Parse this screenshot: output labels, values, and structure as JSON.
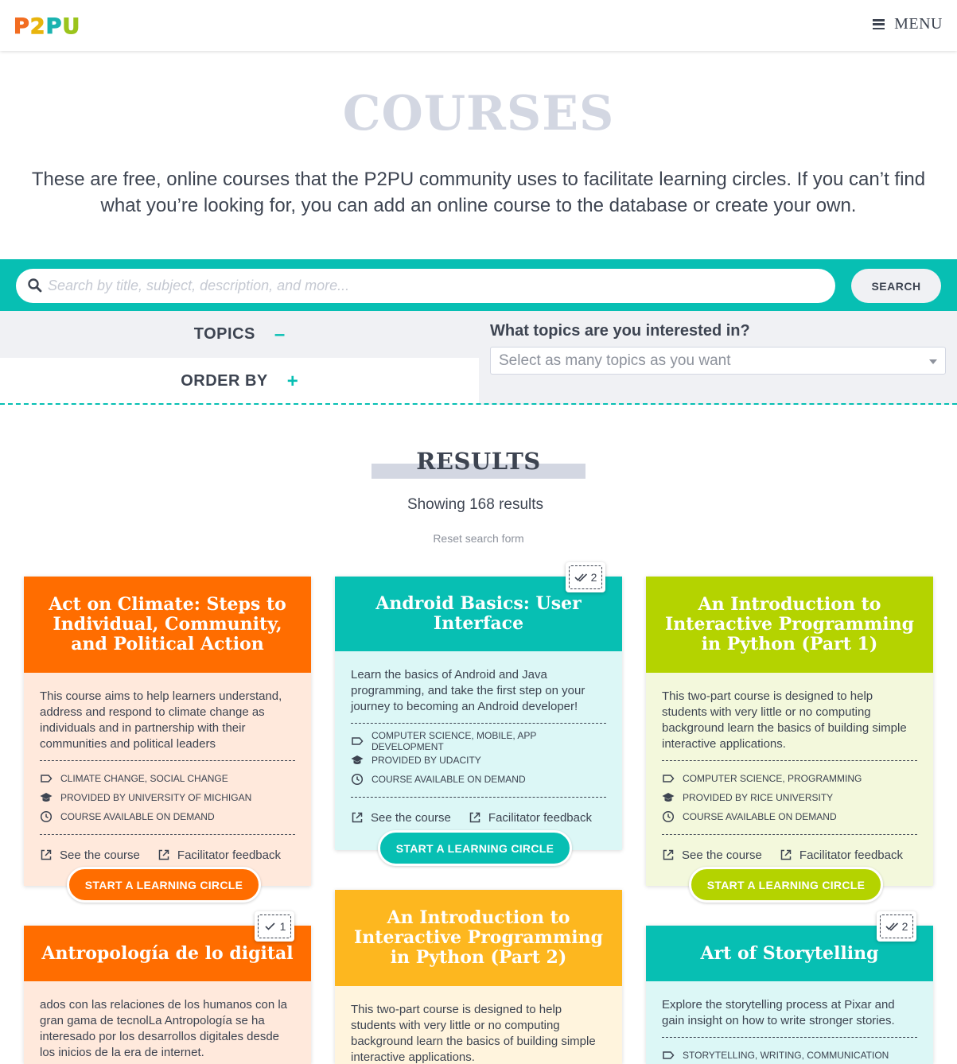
{
  "header": {
    "logo": [
      "P",
      "2",
      "P",
      "U"
    ],
    "menu_label": "MENU"
  },
  "page": {
    "title": "COURSES",
    "intro": "These are free, online courses that the P2PU community uses to facilitate learning circles. If you can’t find what you’re looking for, you can add an online course to the database or create your own."
  },
  "search": {
    "placeholder": "Search by title, subject, description, and more...",
    "button": "SEARCH"
  },
  "filters": {
    "topics_label": "TOPICS",
    "topics_toggle": "–",
    "order_label": "ORDER BY",
    "order_toggle": "+",
    "topics_question": "What topics are you interested in?",
    "topics_placeholder": "Select as many topics as you want"
  },
  "results": {
    "title": "RESULTS",
    "showing": "Showing 168 results",
    "reset": "Reset search form"
  },
  "cards": [
    {
      "title": "Act on Climate: Steps to Individual, Community, and Political Action",
      "description": "This course aims to help learners understand, address and respond to climate change as individuals and in partnership with their communities and political leaders",
      "topics": "CLIMATE CHANGE, SOCIAL CHANGE",
      "provider": "PROVIDED BY UNIVERSITY OF MICHIGAN",
      "availability": "COURSE AVAILABLE ON DEMAND",
      "see_course": "See the course",
      "feedback": "Facilitator feedback",
      "cta": "START A LEARNING CIRCLE",
      "color": "#ff6d00"
    },
    {
      "title": "Android Basics: User Interface",
      "badge": "2",
      "description": "Learn the basics of Android and Java programming, and take the first step on your journey to becoming an Android developer!",
      "topics": "COMPUTER SCIENCE, MOBILE, APP DEVELOPMENT",
      "provider": "PROVIDED BY UDACITY",
      "availability": "COURSE AVAILABLE ON DEMAND",
      "see_course": "See the course",
      "feedback": "Facilitator feedback",
      "cta": "START A LEARNING CIRCLE",
      "color": "#07bfb3"
    },
    {
      "title": "An Introduction to Interactive Programming in Python (Part 1)",
      "description": "This two-part course is designed to help students with very little or no computing background learn the basics of building simple interactive applications.",
      "topics": "COMPUTER SCIENCE, PROGRAMMING",
      "provider": "PROVIDED BY RICE UNIVERSITY",
      "availability": "COURSE AVAILABLE ON DEMAND",
      "see_course": "See the course",
      "feedback": "Facilitator feedback",
      "cta": "START A LEARNING CIRCLE",
      "color": "#b4d300"
    },
    {
      "title": "Antropología de lo digital",
      "badge": "1",
      "description": "ados con las relaciones de los humanos con la gran gama de tecnolLa Antropología se ha interesado por los desarrollos digitales desde los inicios de la era de internet.",
      "color": "#ff6d00"
    },
    {
      "title": "An Introduction to Interactive Programming in Python (Part 2)",
      "description": "This two-part course is designed to help students with very little or no computing background learn the basics of building simple interactive applications.",
      "color": "#fdb71f"
    },
    {
      "title": "Art of Storytelling",
      "badge": "2",
      "description": "Explore the storytelling process at Pixar and gain insight on how to write stronger stories.",
      "topics": "STORYTELLING, WRITING, COMMUNICATION",
      "color": "#07bfb3"
    }
  ]
}
